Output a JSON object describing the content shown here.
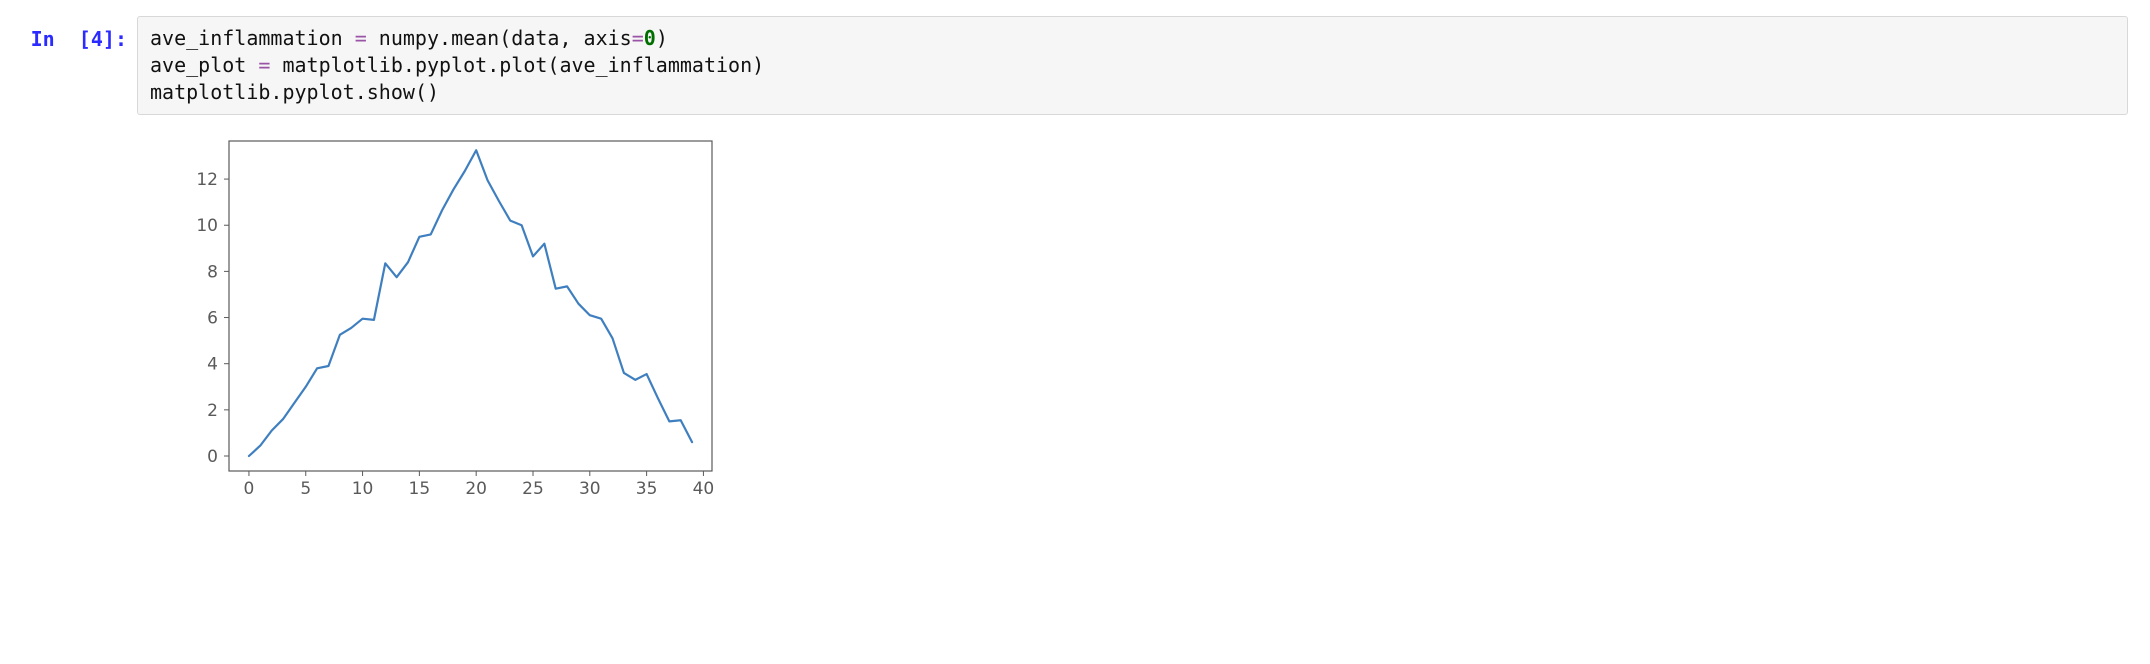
{
  "prompt": {
    "label": "In",
    "n": "4",
    "colon": ":"
  },
  "code": {
    "l1": {
      "a": "ave_inflammation ",
      "op": "= ",
      "b": "numpy",
      "dot": ".",
      "c": "mean",
      "lp": "(",
      "d": "data",
      "comma": ", ",
      "kw": "axis",
      "eq": "=",
      "num": "0",
      "rp": ")"
    },
    "l2": {
      "a": "ave_plot ",
      "op": "= ",
      "b": "matplotlib",
      "dot1": ".",
      "c": "pyplot",
      "dot2": ".",
      "d": "plot",
      "lp": "(",
      "e": "ave_inflammation",
      "rp": ")"
    },
    "l3": {
      "a": "matplotlib",
      "dot1": ".",
      "b": "pyplot",
      "dot2": ".",
      "c": "show",
      "lp": "(",
      "rp": ")"
    }
  },
  "chart_data": {
    "type": "line",
    "title": "",
    "xlabel": "",
    "ylabel": "",
    "xlim": [
      0,
      39
    ],
    "ylim": [
      0,
      13
    ],
    "x_ticks": [
      0,
      5,
      10,
      15,
      20,
      25,
      30,
      35,
      40
    ],
    "y_ticks": [
      0,
      2,
      4,
      6,
      8,
      10,
      12
    ],
    "series": [
      {
        "name": "ave_inflammation",
        "color": "#3f7fbf",
        "x": [
          0,
          1,
          2,
          3,
          4,
          5,
          6,
          7,
          8,
          9,
          10,
          11,
          12,
          13,
          14,
          15,
          16,
          17,
          18,
          19,
          20,
          21,
          22,
          23,
          24,
          25,
          26,
          27,
          28,
          29,
          30,
          31,
          32,
          33,
          34,
          35,
          36,
          37,
          38,
          39
        ],
        "y": [
          0.0,
          0.45,
          1.1,
          1.6,
          2.3,
          3.0,
          3.8,
          3.9,
          5.25,
          5.55,
          5.95,
          5.9,
          8.35,
          7.75,
          8.4,
          9.5,
          9.6,
          10.65,
          11.55,
          12.35,
          13.25,
          11.95,
          11.05,
          10.2,
          10.0,
          8.65,
          9.2,
          7.25,
          7.35,
          6.6,
          6.1,
          5.95,
          5.1,
          3.6,
          3.3,
          3.55,
          2.5,
          1.5,
          1.55,
          0.6
        ]
      }
    ]
  }
}
